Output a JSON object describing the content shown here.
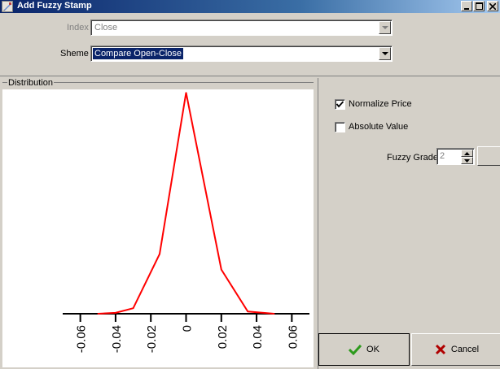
{
  "window": {
    "title": "Add Fuzzy Stamp",
    "controls": [
      "minimize-icon",
      "maximize-icon",
      "close-icon"
    ]
  },
  "form": {
    "index_label": "Index",
    "index_value": "Close",
    "sheme_label": "Sheme",
    "sheme_value": "Compare Open-Close"
  },
  "distribution": {
    "group_label": "Distribution"
  },
  "options": {
    "normalize_price_label": "Normalize Price",
    "normalize_price_checked": true,
    "absolute_value_label": "Absolute Value",
    "absolute_value_checked": false,
    "fuzzy_grade_label": "Fuzzy Grade",
    "fuzzy_grade_value": "2"
  },
  "buttons": {
    "ok_label": "OK",
    "cancel_label": "Cancel"
  },
  "colors": {
    "title_gradient_start": "#0a246a",
    "title_gradient_end": "#a6caf0",
    "series": "#ff0000",
    "selection": "#0a246a",
    "ok_icon": "#2c9a1c",
    "cancel_icon": "#b00000"
  },
  "chart_data": {
    "type": "line",
    "title": "",
    "xlabel": "",
    "ylabel": "",
    "xlim": [
      -0.07,
      0.07
    ],
    "ylim": [
      0,
      1
    ],
    "xticks": [
      -0.06,
      -0.04,
      -0.02,
      0,
      0.02,
      0.04,
      0.06
    ],
    "xtick_labels": [
      "-0.06",
      "-0.04",
      "-0.02",
      "0",
      "0.02",
      "0.04",
      "0.06"
    ],
    "tick_label_rotation": "vertical",
    "grid": false,
    "series": [
      {
        "color": "#ff0000",
        "x": [
          -0.05,
          -0.04,
          -0.03,
          -0.015,
          0,
          0.02,
          0.035,
          0.05
        ],
        "y": [
          0,
          0.004,
          0.025,
          0.27,
          1,
          0.2,
          0.01,
          0
        ]
      }
    ]
  }
}
